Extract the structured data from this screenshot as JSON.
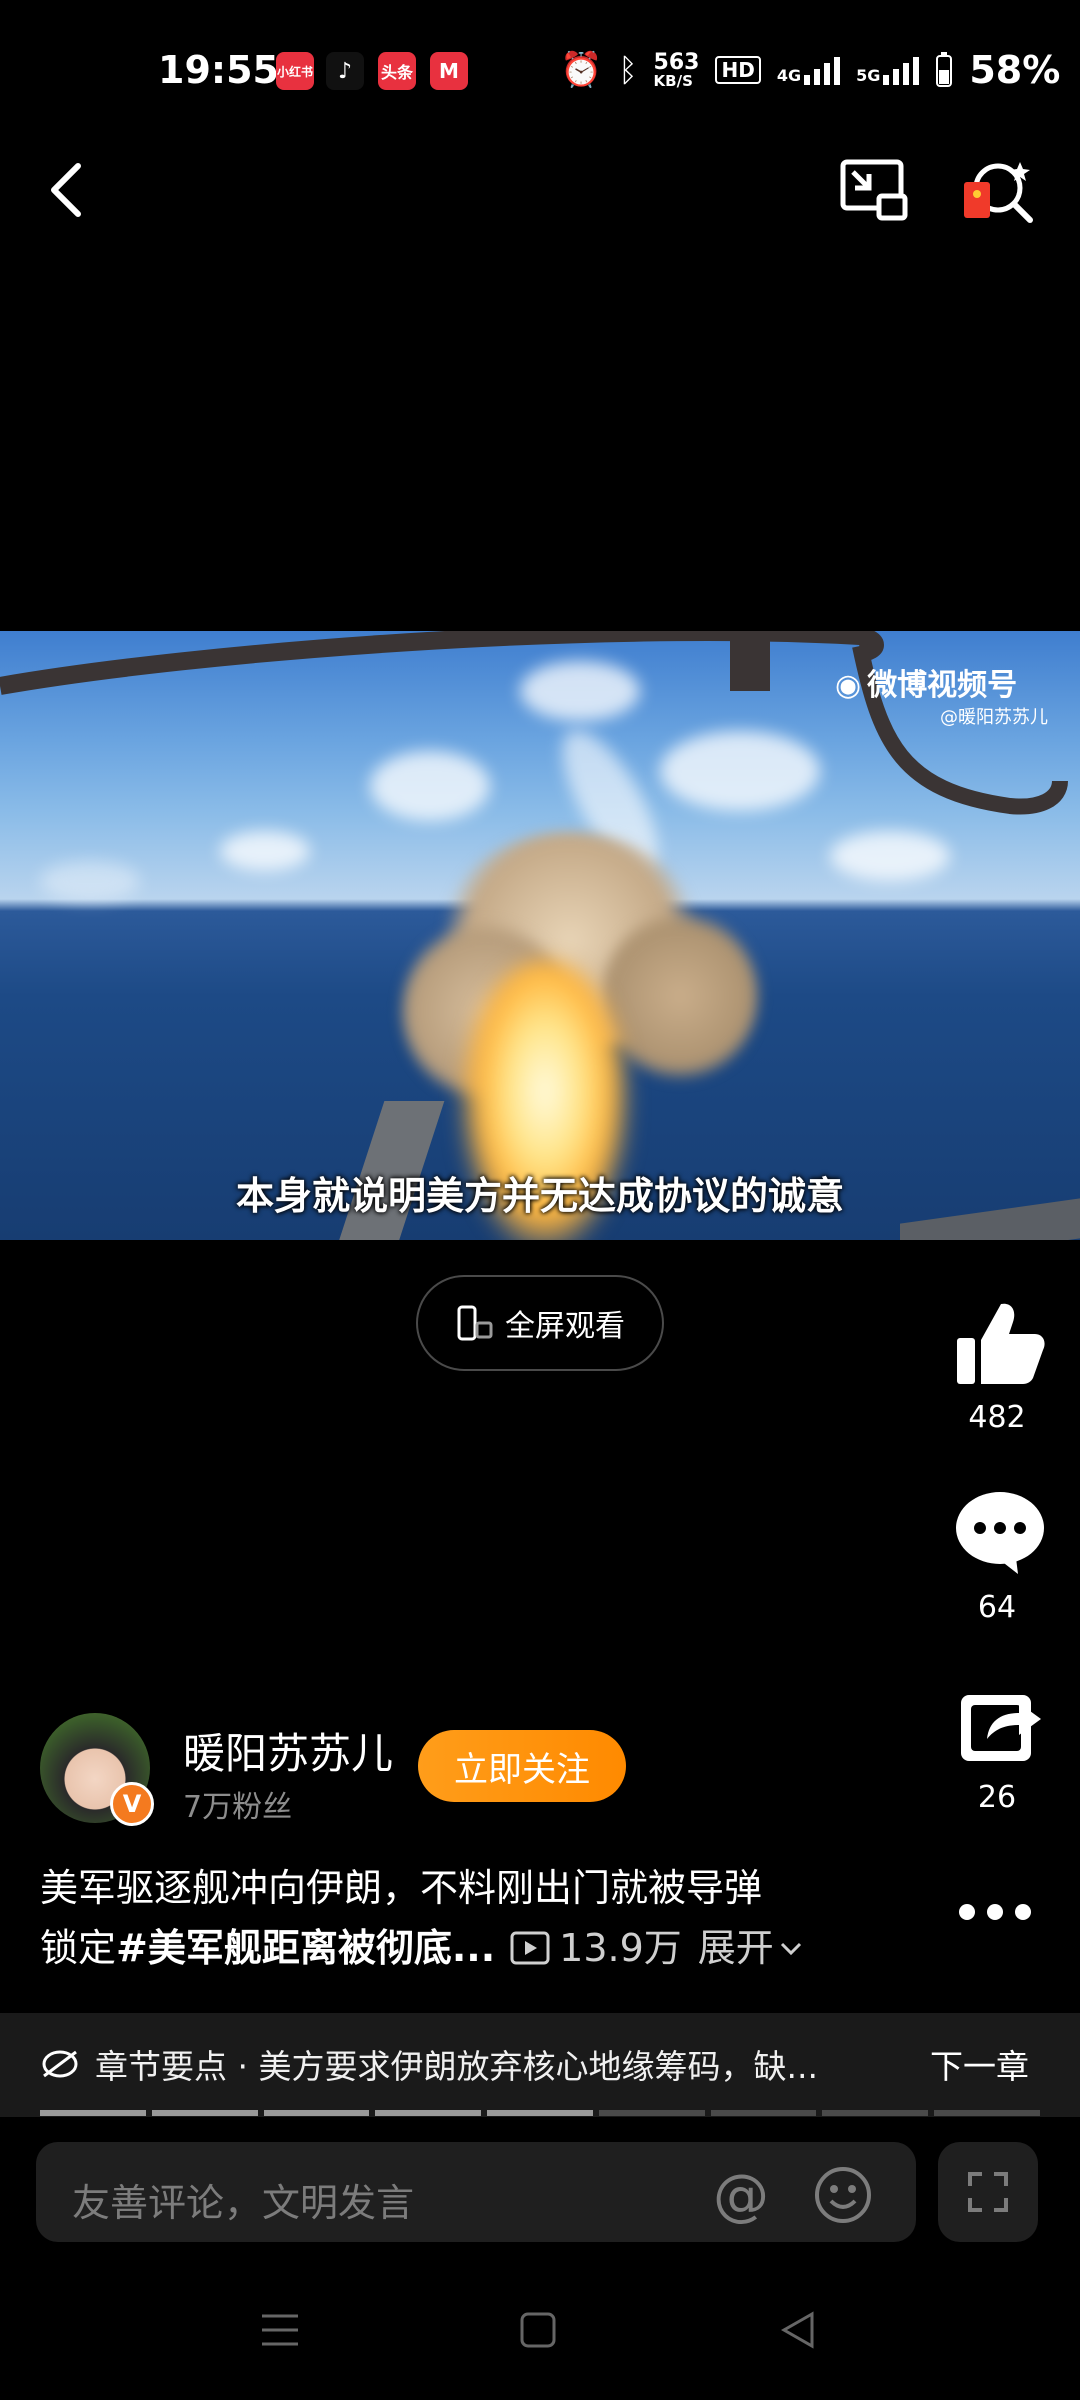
{
  "status_bar": {
    "time": "19:55",
    "app_badges": [
      "小红书",
      "抖音",
      "头条",
      "M"
    ],
    "speed_value": "563",
    "speed_unit": "KB/S",
    "hd_label": "HD",
    "net1": "4G",
    "net2": "5G",
    "battery": "58%"
  },
  "video": {
    "watermark": "微博视频号",
    "watermark_handle": "@暖阳苏苏儿",
    "subtitle": "本身就说明美方并无达成协议的诚意"
  },
  "fullscreen": {
    "label": "全屏观看"
  },
  "actions": {
    "likes": "482",
    "comments": "64",
    "shares": "26"
  },
  "author": {
    "name": "暖阳苏苏儿",
    "fans": "7万粉丝",
    "follow_label": "立即关注",
    "verified_mark": "V"
  },
  "post": {
    "line1": "美军驱逐舰冲向伊朗，不料刚出门就被导弹",
    "line2_prefix": "锁定",
    "hashtag": "#美军舰距离被彻底...",
    "views": "13.9万",
    "expand": "展开"
  },
  "chapter": {
    "text": "章节要点 · 美方要求伊朗放弃核心地缘筹码，缺...",
    "next": "下一章",
    "segments_total": 9,
    "segments_done": 5
  },
  "comment": {
    "placeholder": "友善评论，文明发言"
  },
  "colors": {
    "accent": "#ff9100",
    "background": "#000000"
  }
}
